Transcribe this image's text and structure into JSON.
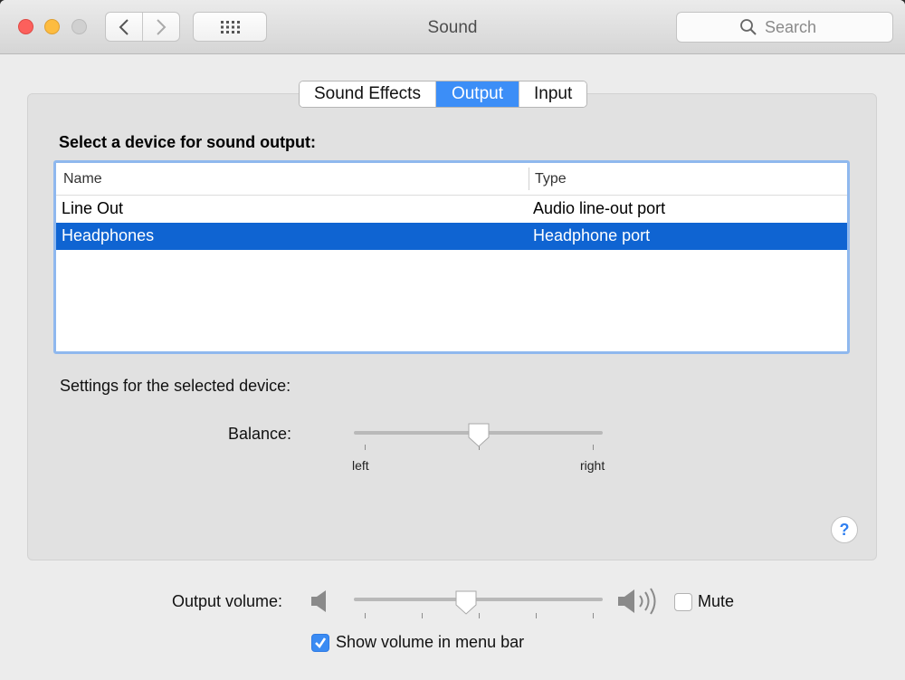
{
  "window": {
    "title": "Sound"
  },
  "toolbar": {
    "search_placeholder": "Search",
    "back_icon": "chevron-left-icon",
    "forward_icon": "chevron-right-icon",
    "grid_icon": "grid-icon"
  },
  "tabs": [
    {
      "label": "Sound Effects",
      "active": false
    },
    {
      "label": "Output",
      "active": true
    },
    {
      "label": "Input",
      "active": false
    }
  ],
  "output": {
    "heading": "Select a device for sound output:",
    "columns": {
      "name": "Name",
      "type": "Type"
    },
    "devices": [
      {
        "name": "Line Out",
        "type": "Audio line-out port",
        "selected": false
      },
      {
        "name": "Headphones",
        "type": "Headphone port",
        "selected": true
      }
    ],
    "settings_label": "Settings for the selected device:",
    "balance": {
      "label": "Balance:",
      "left_label": "left",
      "right_label": "right",
      "value": 0.5
    }
  },
  "volume": {
    "label": "Output volume:",
    "value": 0.45,
    "mute_label": "Mute",
    "mute_checked": false,
    "show_in_menu_bar_label": "Show volume in menu bar",
    "show_in_menu_bar_checked": true
  },
  "help": {
    "label": "?"
  },
  "colors": {
    "accent": "#3c8ef7",
    "selection": "#0f64d2",
    "close": "#fc605c",
    "minimize": "#fdbc40",
    "zoom_inactive": "#d0d0d0"
  }
}
